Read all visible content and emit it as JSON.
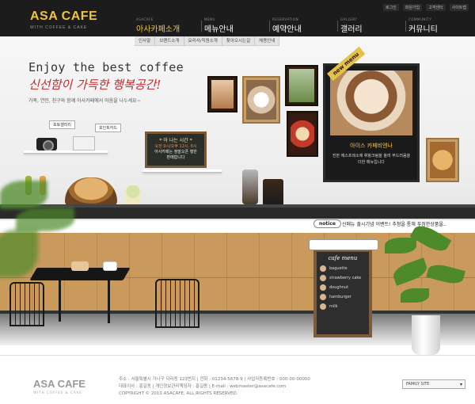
{
  "brand": {
    "title": "ASA CAFE",
    "subtitle": "WITH COFFEE & CAKE"
  },
  "util_links": [
    "로그인",
    "회원가입",
    "고객센터",
    "사이트맵"
  ],
  "nav": [
    {
      "en": "ASACAFE",
      "ko": "아사카페소개"
    },
    {
      "en": "MENU",
      "ko": "메뉴안내"
    },
    {
      "en": "RESERVATION",
      "ko": "예약안내"
    },
    {
      "en": "GALLERY",
      "ko": "갤러리"
    },
    {
      "en": "COMMUNITY",
      "ko": "커뮤니티"
    }
  ],
  "subnav": [
    "인사말",
    "브랜드소개",
    "요리사/직원소개",
    "찾아오시는길",
    "채용안내"
  ],
  "hero": {
    "headline": "Enjoy the best coffee",
    "script": "신선함이 가득한 행복공간!",
    "desc": "가족, 연인, 친구와 함께 아사카페에서 마음을 나누세요~",
    "tag_gallery": "포토갤러리",
    "tag_point": "포인트카드"
  },
  "board": {
    "title": "* 아 나는 시간 *",
    "line1": "오전 9시/오후 12시, 6시",
    "line2": "아사카페는 정말오픈 행한",
    "line3": "판매합니다"
  },
  "feature": {
    "badge": "new menu",
    "title": "아이스 카페비엔나",
    "text": "진한 에스프레소에 휘핑크림을 올려 부드러움을 더한 메뉴입니다"
  },
  "notice": {
    "label": "notice",
    "text": "신메뉴 출시기념 이벤트! 추첨을 통해 푸짐한상품을.."
  },
  "menu_board": {
    "title": "cafe menu",
    "items": [
      "baguette",
      "strawberry cake",
      "doughnut",
      "hamburger",
      "milk"
    ]
  },
  "footer": {
    "logo": "ASA CAFE",
    "sub": "WITH COFFEE & CAKE",
    "line1": "주소 : 서울특별시 가나구 다라동 123번지 | 전화 : 01234-5678-9 | 사업자등록번호 : 000-00-00000",
    "line2": "대표이사 : 홍길동 | 개인정보관리책임자 : 홍길동 | E-mail : webmaster@asacafe.com",
    "line3": "COPYRIGHT © 2010 ASACAFE, ALL RIGHTS RESERVED.",
    "family_site": "FAMILY SITE"
  },
  "colors": {
    "brand_yellow": "#f0c33c",
    "header_bg": "#1c1c1c",
    "script_red": "#c42a2a"
  }
}
